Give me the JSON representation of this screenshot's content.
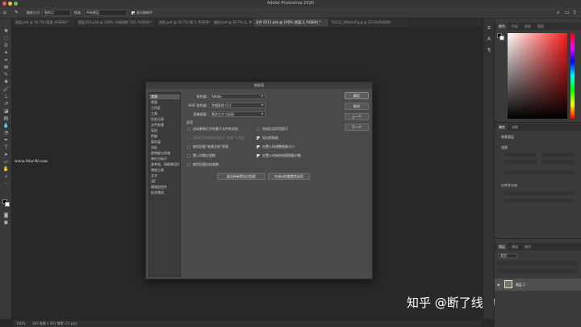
{
  "app": {
    "title": "Adobe Photoshop 2020"
  },
  "options_bar": {
    "sample_size_label": "取样大小:",
    "sample_size_value": "取样点",
    "sample_label": "样本:",
    "sample_value": "所有图层",
    "show_ring_label": "显示取样环"
  },
  "doc_tabs": [
    {
      "label": "图层.psd @ 16.7% (背景, RGB/8) *"
    },
    {
      "label": "图层 621.psb @ 100% (刊新面框 (16), RGB/8) *"
    },
    {
      "label": "选框.psd @ 16.7% (组 1, RGB/8) *"
    },
    {
      "label": "编组.psd @ 16.7% (1, RGB/8) *"
    },
    {
      "label": "文件 6211.psb @ 100% (图层 2, RGB/8) *"
    },
    {
      "label": "52111_Jdfe4scF.jpg @ 33.3%(RGB/8)"
    }
  ],
  "watermark": "www.MacW.com",
  "author_mark": "知乎 @断了线的风筝",
  "status_bar": {
    "zoom": "100%",
    "doc_info": "365 像素 x 441 像素 (72 ppi)"
  },
  "panels": {
    "color_tabs": [
      "颜色",
      "色板",
      "渐变",
      "图案"
    ],
    "properties_tabs": [
      "属性",
      "调整"
    ],
    "properties_title": "像素图层",
    "transform_label": "变换",
    "align_label": "对齐并分布",
    "layers_tabs": [
      "图层",
      "通道",
      "路径"
    ],
    "layer_kind": "类型",
    "layer_name": "图层 2"
  },
  "dialog": {
    "title": "首选项",
    "categories": [
      "常规",
      "界面",
      "工作区",
      "工具",
      "历史记录",
      "文件处理",
      "导出",
      "性能",
      "暂存盘",
      "光标",
      "透明度与色域",
      "单位与标尺",
      "参考线、网格和切片",
      "增效工具",
      "文字",
      "3D",
      "增强型控件",
      "技术预览"
    ],
    "selected_category": "常规",
    "fields": [
      {
        "label": "拾色器:",
        "value": "Adobe"
      },
      {
        "label": "HUD 拾色器:",
        "value": "色相条纹 (小)"
      },
      {
        "label": "图像插值:",
        "value": "两次立方 (自动)"
      }
    ],
    "options_title": "选项",
    "checkboxes_left": [
      {
        "label": "自动更新打开的基于文件的文档",
        "checked": false,
        "disabled": false
      },
      {
        "label": "没有打开的文档时显示“开始”工作区",
        "checked": false,
        "disabled": true
      },
      {
        "label": "使用旧版“新建文档”界面",
        "checked": false,
        "disabled": false
      },
      {
        "label": "置入时跳过变换",
        "checked": false,
        "disabled": false
      },
      {
        "label": "使用旧版自由变换",
        "checked": false,
        "disabled": false
      }
    ],
    "checkboxes_right": [
      {
        "label": "完成后用声音提示",
        "checked": false,
        "disabled": false
      },
      {
        "label": "导出剪贴板",
        "checked": true,
        "disabled": false
      },
      {
        "label": "在置入时调整图像大小",
        "checked": true,
        "disabled": false
      },
      {
        "label": "在置入时始终创建智能对象",
        "checked": true,
        "disabled": false
      }
    ],
    "reset_warnings_button": "复位所有警告对话框",
    "reset_on_quit_button": "在退出时重置首选项",
    "buttons": [
      "确定",
      "取消",
      "上一个",
      "下一个"
    ]
  }
}
